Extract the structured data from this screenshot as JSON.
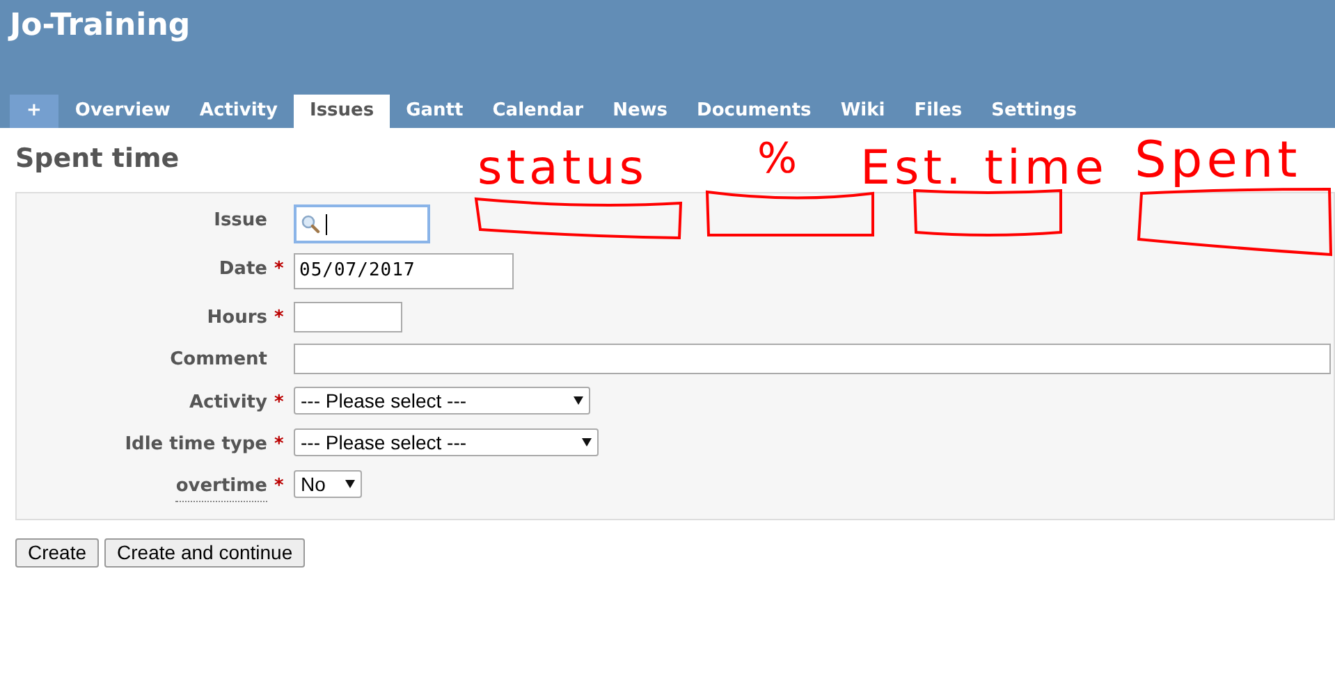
{
  "header": {
    "title": "Jo-Training"
  },
  "tabs": [
    {
      "label": "+",
      "kind": "new",
      "selected": false
    },
    {
      "label": "Overview",
      "kind": "tab",
      "selected": false
    },
    {
      "label": "Activity",
      "kind": "tab",
      "selected": false
    },
    {
      "label": "Issues",
      "kind": "tab",
      "selected": true
    },
    {
      "label": "Gantt",
      "kind": "tab",
      "selected": false
    },
    {
      "label": "Calendar",
      "kind": "tab",
      "selected": false
    },
    {
      "label": "News",
      "kind": "tab",
      "selected": false
    },
    {
      "label": "Documents",
      "kind": "tab",
      "selected": false
    },
    {
      "label": "Wiki",
      "kind": "tab",
      "selected": false
    },
    {
      "label": "Files",
      "kind": "tab",
      "selected": false
    },
    {
      "label": "Settings",
      "kind": "tab",
      "selected": false
    }
  ],
  "page_title": "Spent time",
  "form": [
    {
      "label": "Issue",
      "kind": "search",
      "focused": true
    },
    {
      "label": "Date",
      "kind": "date",
      "required_mark": "*",
      "value": "05/07/2017"
    },
    {
      "label": "Hours",
      "kind": "short",
      "required_mark": "*"
    },
    {
      "label": "Comment",
      "kind": "wide"
    },
    {
      "label": "Activity",
      "kind": "select",
      "required_mark": "*",
      "value": "--- Please select ---"
    },
    {
      "label": "Idle time type",
      "kind": "select",
      "required_mark": "*",
      "value": "--- Please select ---"
    },
    {
      "label": "overtime",
      "kind": "small-select",
      "required_mark": "*",
      "value": "No",
      "has_hint": true
    }
  ],
  "buttons": [
    "Create",
    "Create and continue"
  ],
  "annotations": [
    {
      "text": "status"
    },
    {
      "text": "%"
    },
    {
      "text": "Est. time"
    },
    {
      "text": "Spent"
    }
  ]
}
